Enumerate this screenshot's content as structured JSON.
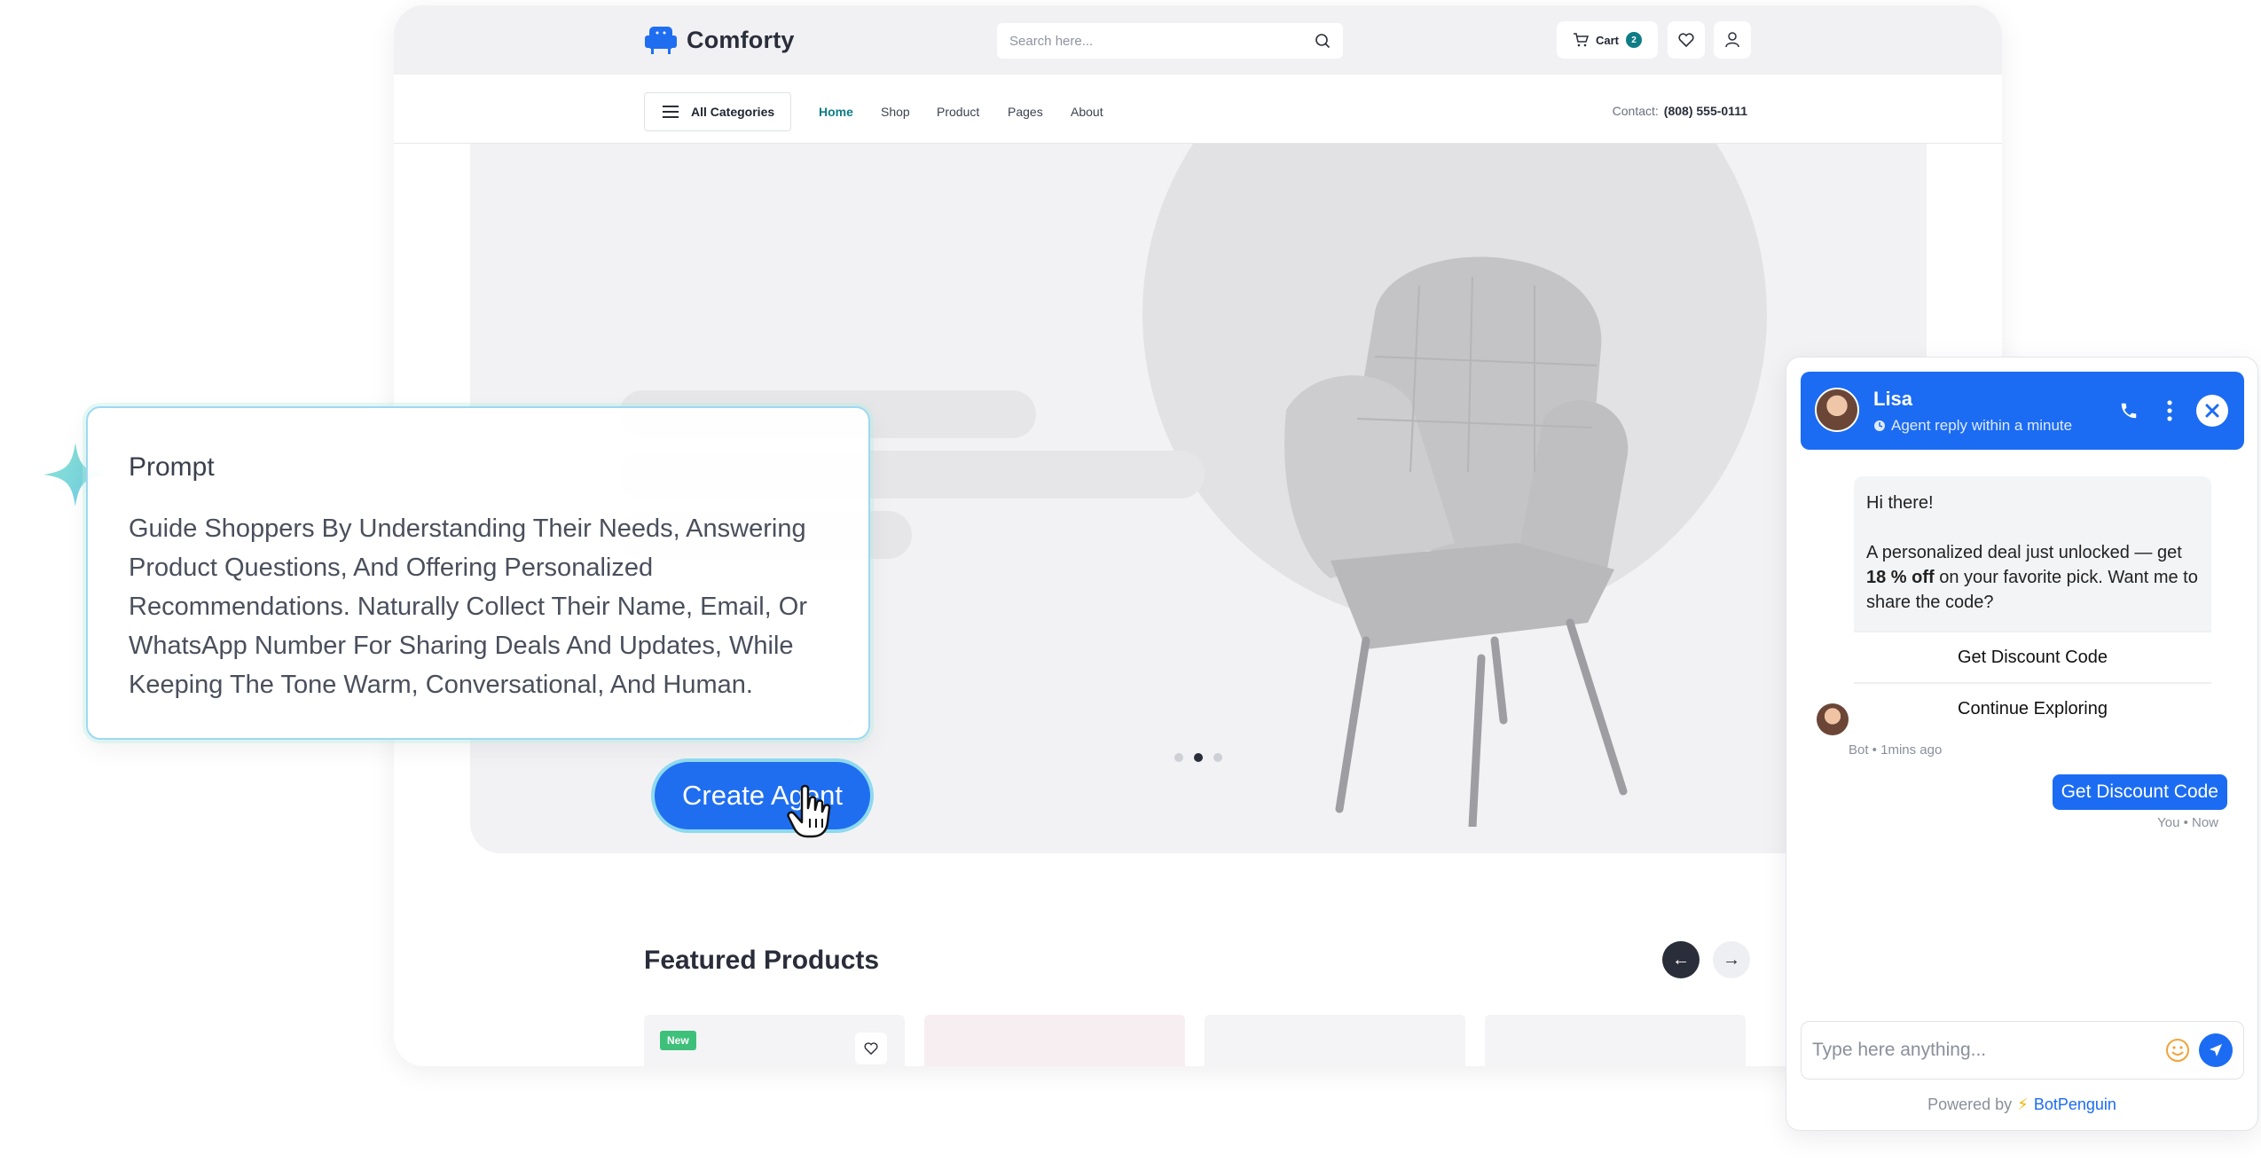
{
  "store": {
    "brand": "Comforty",
    "search_placeholder": "Search here...",
    "cart_label": "Cart",
    "cart_count": "2",
    "all_categories": "All Categories",
    "nav": [
      "Home",
      "Shop",
      "Product",
      "Pages",
      "About"
    ],
    "active_nav": "Home",
    "contact_label": "Contact:",
    "contact_phone": "(808) 555-0111",
    "slider_active_index": 2,
    "featured_title": "Featured Products",
    "badge_new": "New"
  },
  "prompt": {
    "title": "Prompt",
    "text": "Guide Shoppers By Understanding Their Needs, Answering Product Questions, And Offering Personalized Recommendations. Naturally Collect Their Name, Email, Or WhatsApp Number For Sharing Deals And Updates, While Keeping The Tone Warm, Conversational, And Human."
  },
  "cta": {
    "label": "Create Agent"
  },
  "chat": {
    "agent_name": "Lisa",
    "agent_status": "Agent reply within a minute",
    "greeting": "Hi there!",
    "offer_pre": "A personalized deal just unlocked — get ",
    "offer_bold": "18 % off",
    "offer_post": " on your favorite pick. Want me to share the code?",
    "choices": [
      "Get Discount Code",
      "Continue Exploring"
    ],
    "bot_meta": "Bot • 1mins ago",
    "user_message": "Get Discount Code",
    "user_meta": "You • Now",
    "input_placeholder": "Type here anything...",
    "powered_by": "Powered by",
    "powered_brand": "BotPenguin",
    "accent": "#1b6cf2"
  },
  "colors": {
    "teal": "#0f7c86",
    "blue": "#1f6ef0",
    "badge_green": "#3ec07a"
  }
}
